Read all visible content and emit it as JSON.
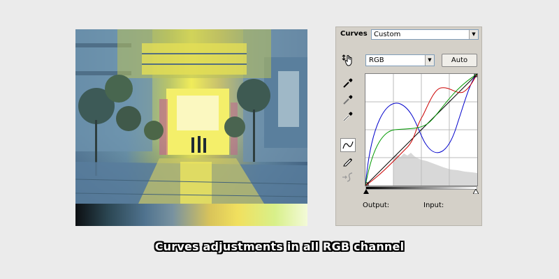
{
  "preview": {
    "gradient_stops": [
      "#0c0f12",
      "#2b4652",
      "#50738f",
      "#7892a0",
      "#d9c45a",
      "#f1e05e",
      "#d8f08a",
      "#f3fad8"
    ]
  },
  "curves_panel": {
    "title": "Curves",
    "preset": "Custom",
    "channel": "RGB",
    "auto_label": "Auto",
    "output_label": "Output:",
    "input_label": "Input:",
    "tools": [
      "on-image-adjust-icon",
      "black-point-eyedropper-icon",
      "gray-point-eyedropper-icon",
      "white-point-eyedropper-icon",
      "curve-point-icon",
      "pencil-icon",
      "smooth-curve-icon"
    ],
    "curve_colors": {
      "red": "#cc0000",
      "green": "#009900",
      "blue": "#0000cc",
      "baseline": "#000000"
    }
  },
  "caption": "Curves adjustments in all RGB channel"
}
